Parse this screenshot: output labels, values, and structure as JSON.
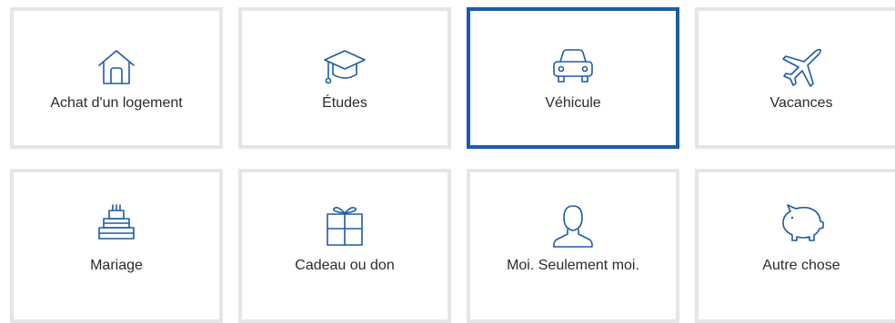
{
  "colors": {
    "accent": "#1e5aa8",
    "tile_border": "#e6e6e6",
    "text": "#2b2b2b"
  },
  "options": [
    {
      "label": "Achat d'un logement",
      "icon": "house-icon",
      "selected": false
    },
    {
      "label": "Études",
      "icon": "graduation-cap-icon",
      "selected": false
    },
    {
      "label": "Véhicule",
      "icon": "car-icon",
      "selected": true
    },
    {
      "label": "Vacances",
      "icon": "airplane-icon",
      "selected": false
    },
    {
      "label": "Mariage",
      "icon": "wedding-cake-icon",
      "selected": false
    },
    {
      "label": "Cadeau ou don",
      "icon": "gift-icon",
      "selected": false
    },
    {
      "label": "Moi. Seulement moi.",
      "icon": "person-icon",
      "selected": false
    },
    {
      "label": "Autre chose",
      "icon": "piggy-bank-icon",
      "selected": false
    }
  ]
}
